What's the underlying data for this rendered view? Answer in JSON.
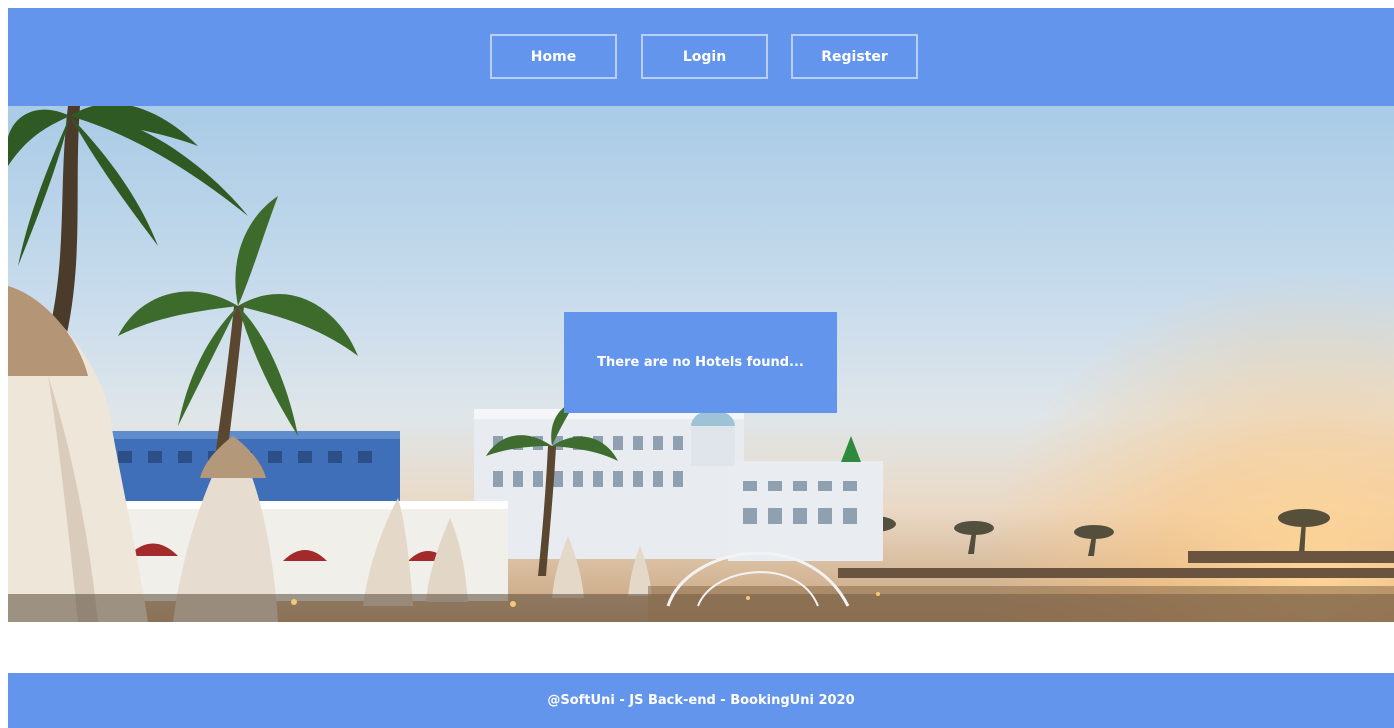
{
  "nav": {
    "home_label": "Home",
    "login_label": "Login",
    "register_label": "Register"
  },
  "main": {
    "empty_message": "There are no Hotels found..."
  },
  "footer": {
    "text": "@SoftUni - JS Back-end - BookingUni 2020"
  },
  "colors": {
    "accent": "#6495ed",
    "text": "#ffffff"
  }
}
